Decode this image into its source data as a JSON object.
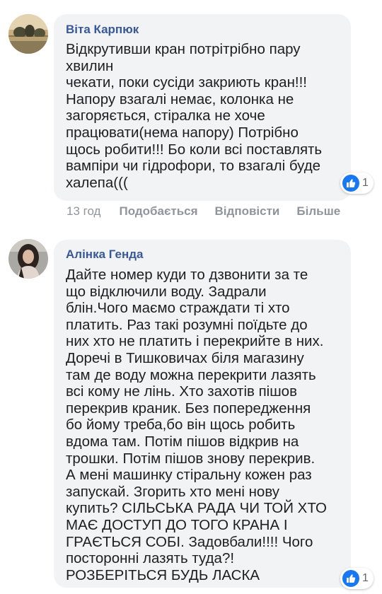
{
  "comments": [
    {
      "author": "Віта Карпюк",
      "lines": [
        "Відкрутивши кран потрітрібно пару",
        "хвилин",
        "чекати, поки сусіди закриють кран!!!",
        "Напору взагалі немає, колонка не",
        "загоряється, стіралка не хоче",
        "працювати(нема напору) Потрібно",
        "щось робити!!! Бо коли всі поставлять",
        "вампіри чи гідрофори, то взагалі буде",
        "халепа((("
      ],
      "reaction_count": "1",
      "timestamp": "13 год",
      "like_label": "Подобається",
      "reply_label": "Відповісти",
      "more_label": "Більше"
    },
    {
      "author": "Алінка Генда",
      "lines": [
        "Дайте номер куди то дзвонити за те",
        "що відключили воду. Задрали",
        "блін.Чого маємо страждати ті хто",
        "платить. Раз такі розумні поїдьте до",
        "них хто не платить і перекрийте в них.",
        "Доречі в Тишковичах біля магазину",
        "там де воду можна перекрити лазять",
        "всі кому не лінь. Хто захотів пішов",
        "перекрив краник. Без попередження",
        "бо йому треба,бо він щось робить",
        "вдома там. Потім пішов відкрив на",
        "трошки. Потім пішов знову перекрив.",
        "А мені машинку стіральну кожен раз",
        "запускай. Згорить хто мені нову",
        "купить? СІЛЬСЬКА РАДА ЧИ ТОЙ ХТО",
        "МАЄ ДОСТУП ДО ТОГО КРАНА І",
        "ГРАЄТЬСЯ СОБІ. Задовбали!!!! Чого",
        "посторонні лазять туда?!",
        "РОЗБЕРІТЬСЯ БУДЬ ЛАСКА"
      ],
      "reaction_count": "1"
    }
  ],
  "colors": {
    "bubble": "#f2f3f5",
    "author": "#385898",
    "text": "#1c1e21",
    "meta": "#90949c",
    "like": "#1877f2"
  }
}
